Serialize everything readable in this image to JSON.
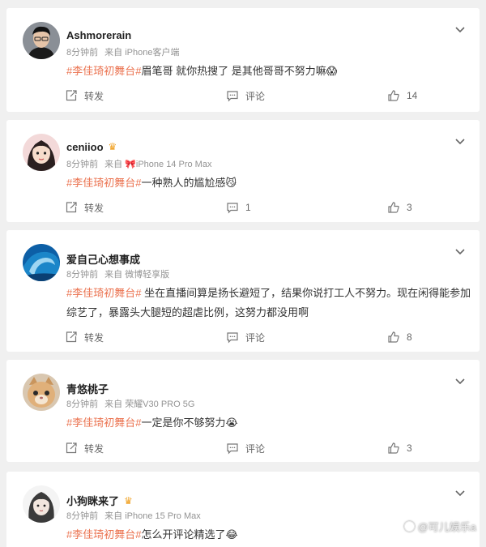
{
  "actions": {
    "repost": "转发",
    "comment": "评论"
  },
  "watermark": "@可儿娱乐a",
  "colors": {
    "hashtag": "#eb7350",
    "meta": "#939393",
    "background": "#f0f0f0"
  },
  "posts": [
    {
      "username": "Ashmorerain",
      "time": "8分钟前",
      "source_prefix": "来自",
      "source": "iPhone客户端",
      "hashtag": "#李佳琦初舞台#",
      "text": "眉笔哥 就你热搜了 是其他哥哥不努力嘛",
      "emoji": "😱",
      "comment_count": "",
      "like_count": "14",
      "avatar_icon": "avatar-young-man-glasses"
    },
    {
      "username": "ceniioo",
      "badge_icon": "crown-badge-icon",
      "time": "8分钟前",
      "source_prefix": "来自",
      "source": "🎀iPhone 14 Pro Max",
      "hashtag": "#李佳琦初舞台#",
      "text": "一种熟人的尴尬感",
      "emoji": "😼",
      "comment_count": "1",
      "like_count": "3",
      "avatar_icon": "avatar-woman-cartoon"
    },
    {
      "username": "爱自己心想事成",
      "time": "8分钟前",
      "source_prefix": "来自",
      "source": "微博轻享版",
      "hashtag": "#李佳琦初舞台#",
      "text": " 坐在直播间算是扬长避短了，结果你说打工人不努力。现在闲得能参加综艺了，暴露头大腿短的超虐比例，这努力都没用啊",
      "emoji": "",
      "comment_count": "",
      "like_count": "8",
      "avatar_icon": "avatar-ocean-wave"
    },
    {
      "username": "青悠桃子",
      "time": "8分钟前",
      "source_prefix": "来自",
      "source": "荣耀V30 PRO 5G",
      "hashtag": "#李佳琦初舞台#",
      "text": "一定是你不够努力",
      "emoji": "😭",
      "comment_count": "",
      "like_count": "3",
      "avatar_icon": "avatar-kitten"
    },
    {
      "username": "小狗眯来了",
      "badge_icon": "crown-badge-icon",
      "time": "8分钟前",
      "source_prefix": "来自",
      "source": "iPhone 15 Pro Max",
      "hashtag": "#李佳琦初舞台#",
      "text": "怎么开评论精选了",
      "emoji": "😂",
      "comment_count": "",
      "like_count": "",
      "avatar_icon": "avatar-woman-sketch"
    }
  ]
}
